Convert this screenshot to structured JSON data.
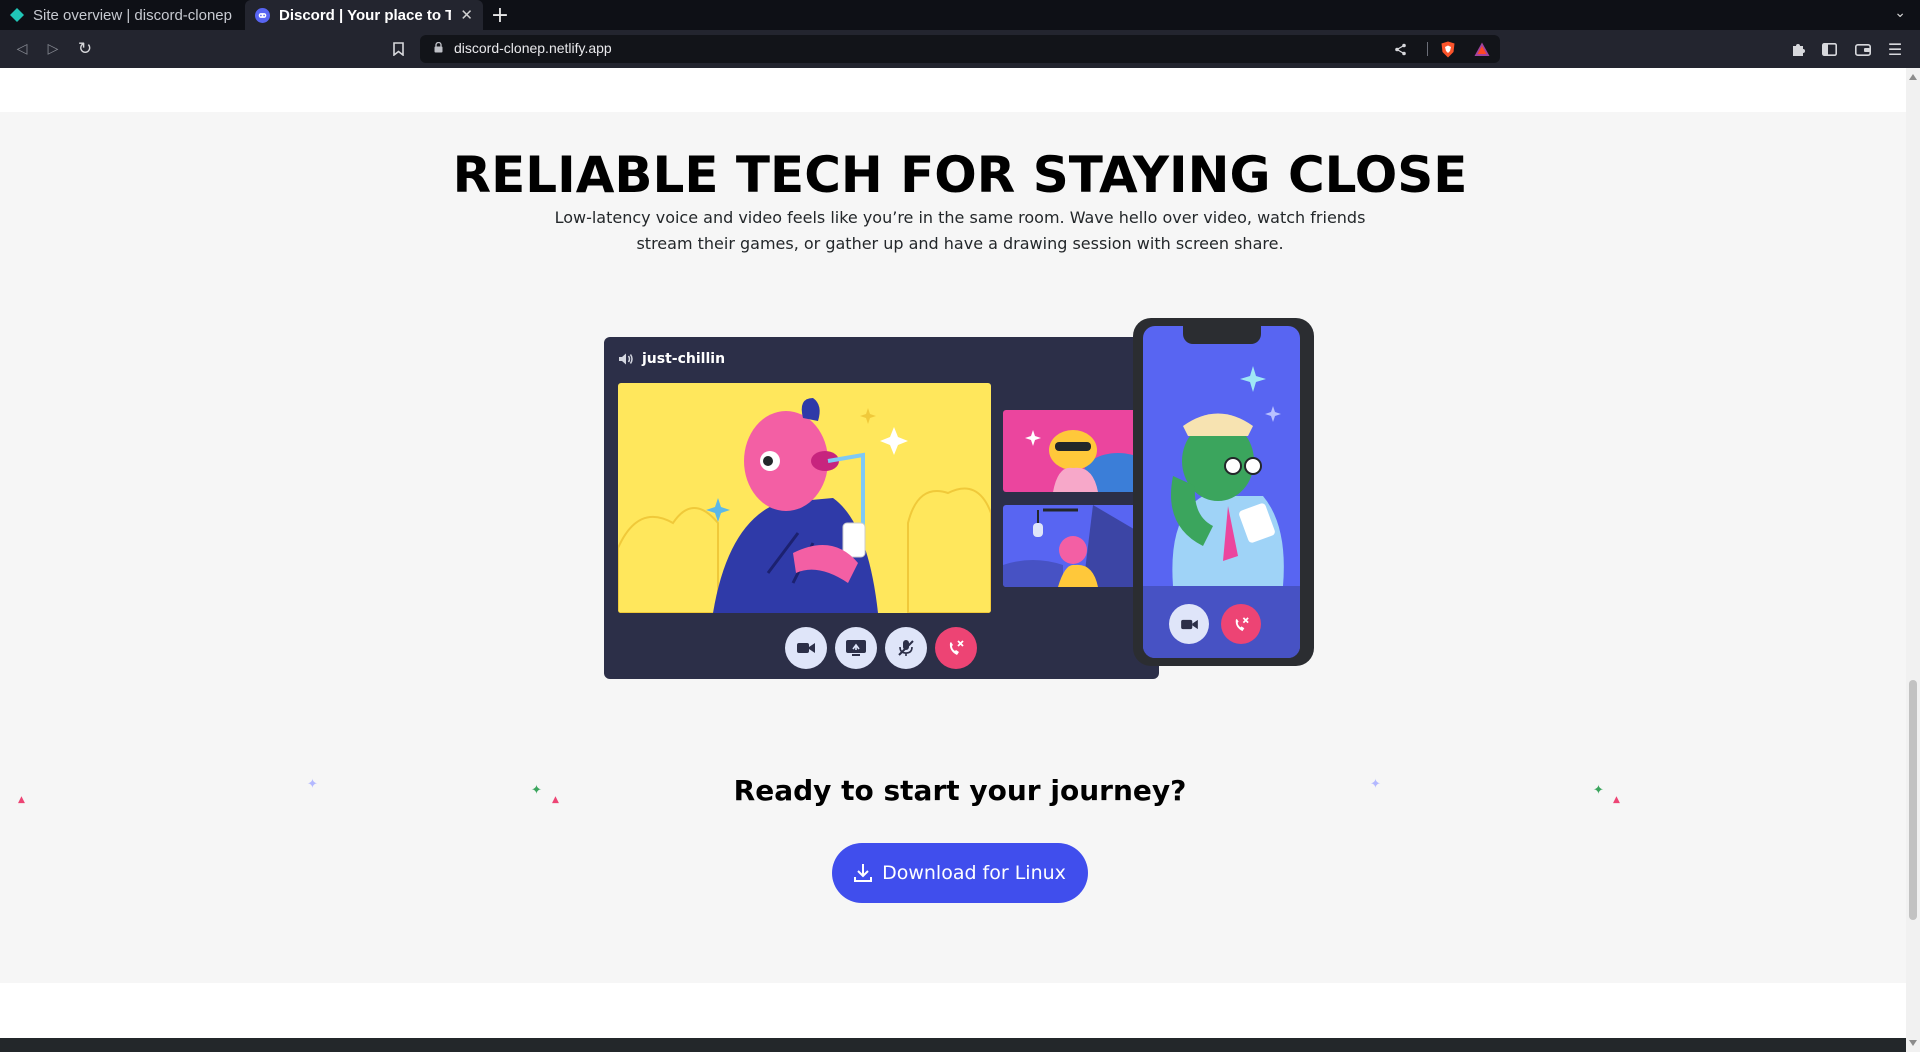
{
  "browser": {
    "tabs": [
      {
        "title": "Site overview | discord-clonep",
        "active": false
      },
      {
        "title": "Discord | Your place to Talk",
        "active": true
      }
    ],
    "new_tab": "+",
    "url": "discord-clonep.netlify.app"
  },
  "hero": {
    "heading": "RELIABLE TECH FOR STAYING CLOSE",
    "subtext": "Low-latency voice and video feels like you’re in the same room. Wave hello over video, watch friends stream their games, or gather up and have a drawing session with screen share."
  },
  "call_window": {
    "channel": "just-chillin",
    "controls": [
      "camera-icon",
      "screen-share-icon",
      "mute-icon",
      "hang-up-icon"
    ]
  },
  "phone": {
    "controls": [
      "camera-icon",
      "hang-up-icon"
    ]
  },
  "cta": {
    "title": "Ready to start your journey?",
    "button_label": "Download for Linux"
  },
  "colors": {
    "blurple": "#404eed",
    "hang_up": "#ed4474",
    "yellow": "#ffe75c",
    "pink": "#eb459e"
  }
}
